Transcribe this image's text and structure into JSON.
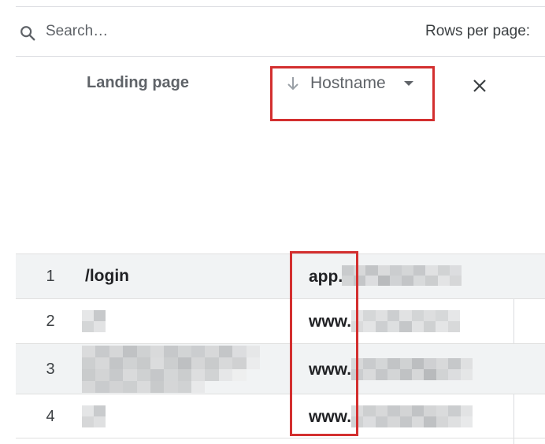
{
  "search": {
    "placeholder": "Search…"
  },
  "pagination": {
    "rows_per_page_label": "Rows per page:"
  },
  "table": {
    "columns": {
      "landing_page": "Landing page",
      "hostname": "Hostname"
    },
    "rows": [
      {
        "index": "1",
        "landing_page": "/login",
        "hostname_prefix": "app."
      },
      {
        "index": "2",
        "landing_page": "",
        "hostname_prefix": "www."
      },
      {
        "index": "3",
        "landing_page": "",
        "hostname_prefix": "www."
      },
      {
        "index": "4",
        "landing_page": "",
        "hostname_prefix": "www."
      }
    ]
  },
  "icons": {
    "search": "search-icon",
    "sort": "arrow-down-icon",
    "dropdown": "caret-down-icon",
    "close": "close-icon"
  },
  "colors": {
    "highlight": "#d32f2f",
    "header_text": "#5f6368",
    "row_shade": "#f1f3f4",
    "divider": "#dadce0"
  }
}
